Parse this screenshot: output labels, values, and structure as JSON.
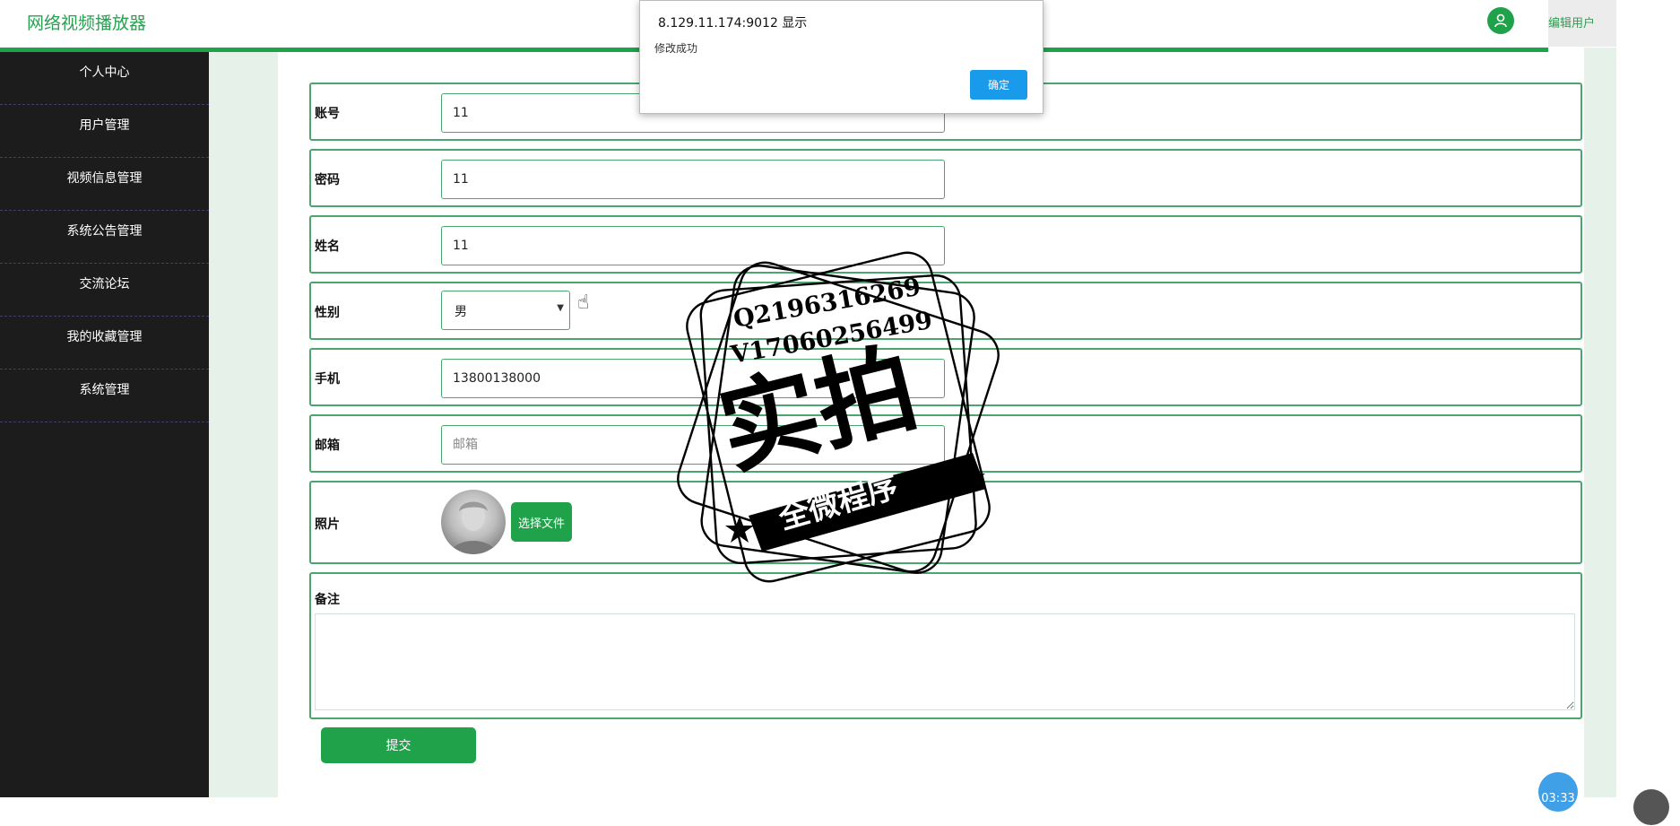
{
  "app": {
    "title": "网络视频播放器"
  },
  "header": {
    "user_label": "编辑用户",
    "avatar_icon": "user-icon",
    "accent": "#1fa24a"
  },
  "sidebar": {
    "items": [
      {
        "label": "个人中心"
      },
      {
        "label": "用户管理"
      },
      {
        "label": "视频信息管理"
      },
      {
        "label": "系统公告管理"
      },
      {
        "label": "交流论坛"
      },
      {
        "label": "我的收藏管理"
      },
      {
        "label": "系统管理"
      }
    ]
  },
  "form": {
    "account": {
      "label": "账号",
      "value": "11"
    },
    "password": {
      "label": "密码",
      "value": "11"
    },
    "name": {
      "label": "姓名",
      "value": "11"
    },
    "gender": {
      "label": "性别",
      "value": "男"
    },
    "phone": {
      "label": "手机",
      "value": "13800138000"
    },
    "email": {
      "label": "邮箱",
      "value": "",
      "placeholder": "邮箱"
    },
    "photo": {
      "label": "照片",
      "choose_label": "选择文件"
    },
    "remark": {
      "label": "备注",
      "value": ""
    },
    "submit_label": "提交"
  },
  "dialog": {
    "title": "8.129.11.174:9012 显示",
    "message": "修改成功",
    "ok_label": "确定"
  },
  "watermark": {
    "line1": "Q2196316269",
    "line2": "V17060256499",
    "main": "实拍",
    "banner": "全微程序"
  },
  "timer": {
    "value": "03:33"
  }
}
